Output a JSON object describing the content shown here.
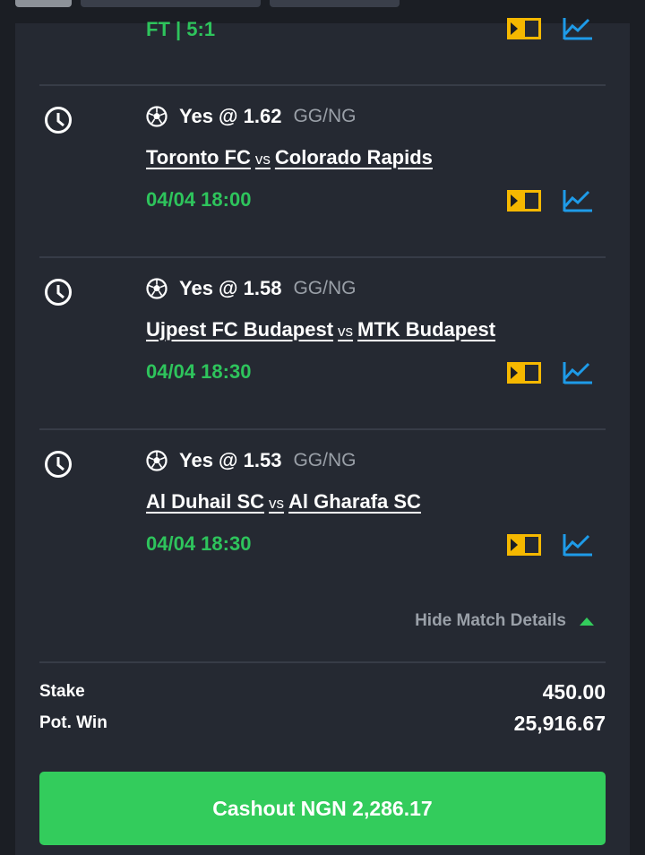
{
  "colors": {
    "accent_green": "#33cc5c",
    "time_green": "#2ec45c",
    "tv_yellow": "#f5b800",
    "stats_blue": "#1e9be8",
    "muted": "#9aa0a8"
  },
  "prev_match": {
    "result": "FT | 5:1"
  },
  "selections": [
    {
      "pick": "Yes @ 1.62",
      "market": "GG/NG",
      "home": "Toronto FC",
      "vs": "vs",
      "away": "Colorado Rapids",
      "datetime": "04/04 18:00",
      "status_icon": "clock-icon",
      "sport_icon": "soccer-ball-icon"
    },
    {
      "pick": "Yes @ 1.58",
      "market": "GG/NG",
      "home": "Ujpest FC Budapest",
      "vs": "vs",
      "away": "MTK Budapest",
      "datetime": "04/04 18:30",
      "status_icon": "clock-icon",
      "sport_icon": "soccer-ball-icon"
    },
    {
      "pick": "Yes @ 1.53",
      "market": "GG/NG",
      "home": "Al Duhail SC",
      "vs": "vs",
      "away": "Al Gharafa SC",
      "datetime": "04/04 18:30",
      "status_icon": "clock-icon",
      "sport_icon": "soccer-ball-icon"
    }
  ],
  "details_toggle": {
    "label": "Hide Match Details",
    "icon": "caret-up-icon"
  },
  "summary": {
    "stake_label": "Stake",
    "stake_value": "450.00",
    "potwin_label": "Pot. Win",
    "potwin_value": "25,916.67"
  },
  "cashout": {
    "label": "Cashout NGN 2,286.17"
  }
}
